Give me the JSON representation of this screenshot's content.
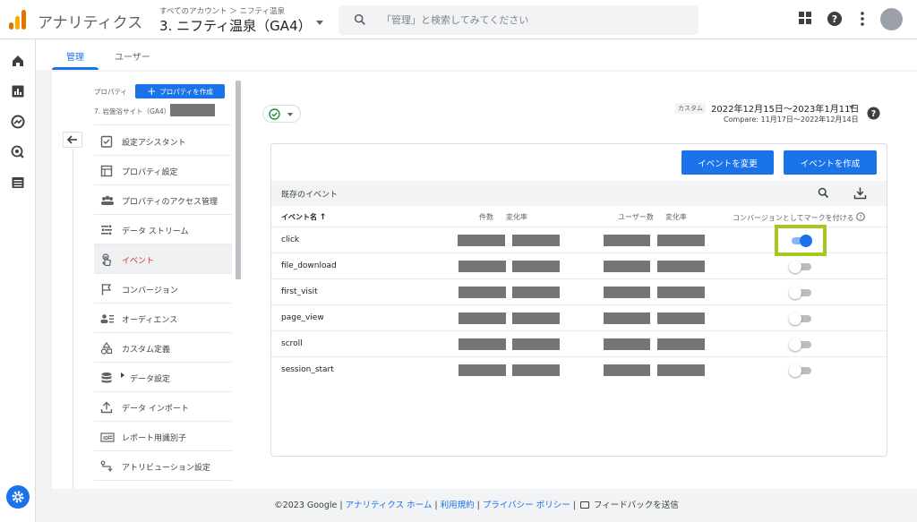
{
  "header": {
    "app_title": "アナリティクス",
    "breadcrumb": "すべてのアカウント ＞ ニフティ温泉",
    "property_title": "3. ニフティ温泉（GA4）",
    "search_placeholder": "「管理」と検索してみてください"
  },
  "tabs": [
    {
      "label": "管理",
      "active": true
    },
    {
      "label": "ユーザー",
      "active": false
    }
  ],
  "admin_panel": {
    "property_label": "プロパティ",
    "create_property_label": "プロパティを作成",
    "property_name": "7. 岩盤浴サイト（GA4）",
    "menu": [
      {
        "label": "設定アシスタント",
        "icon": "checklist-icon"
      },
      {
        "label": "プロパティ設定",
        "icon": "layout-icon"
      },
      {
        "label": "プロパティのアクセス管理",
        "icon": "people-icon"
      },
      {
        "label": "データ ストリーム",
        "icon": "streams-icon"
      },
      {
        "label": "イベント",
        "icon": "touch-icon",
        "active": true
      },
      {
        "label": "コンバージョン",
        "icon": "flag-icon"
      },
      {
        "label": "オーディエンス",
        "icon": "audience-icon"
      },
      {
        "label": "カスタム定義",
        "icon": "shapes-icon"
      },
      {
        "label": "データ設定",
        "icon": "database-icon"
      },
      {
        "label": "データ インポート",
        "icon": "upload-icon"
      },
      {
        "label": "レポート用識別子",
        "icon": "id-icon"
      },
      {
        "label": "アトリビューション設定",
        "icon": "route-icon"
      }
    ]
  },
  "date": {
    "badge": "カスタム",
    "range": "2022年12月15日～2023年1月11日",
    "compare": "Compare: 11月17日～2022年12月14日"
  },
  "events_card": {
    "modify_button": "イベントを変更",
    "create_button": "イベントを作成",
    "subhead": "既存のイベント",
    "columns": {
      "event_name": "イベント名",
      "count": "件数",
      "count_change": "変化率",
      "users": "ユーザー数",
      "users_change": "変化率",
      "conversion": "コンバージョンとしてマークを付ける"
    },
    "rows": [
      {
        "name": "click",
        "conversion": true
      },
      {
        "name": "file_download",
        "conversion": false
      },
      {
        "name": "first_visit",
        "conversion": false
      },
      {
        "name": "page_view",
        "conversion": false
      },
      {
        "name": "scroll",
        "conversion": false
      },
      {
        "name": "session_start",
        "conversion": false
      }
    ]
  },
  "footer": {
    "copyright": "©2023 Google",
    "links": [
      "アナリティクス ホーム",
      "利用規約",
      "プライバシー ポリシー"
    ],
    "feedback": "フィードバックを送信"
  },
  "colors": {
    "accent": "#1a73e8",
    "highlight": "#a4c81e",
    "active_menu_text": "#d93025"
  }
}
